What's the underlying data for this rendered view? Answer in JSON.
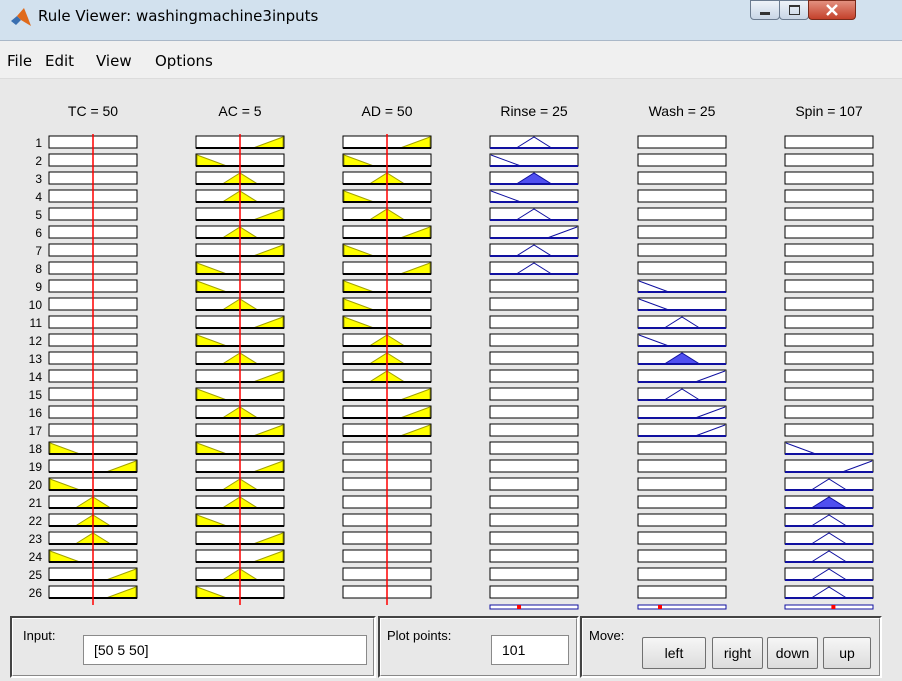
{
  "window": {
    "title": "Rule Viewer: washingmachine3inputs",
    "controls": {
      "minimize": "minimize-icon",
      "maximize": "maximize-icon",
      "close": "close-icon"
    }
  },
  "menu": {
    "items": [
      "File",
      "Edit",
      "View",
      "Options"
    ]
  },
  "variables": [
    {
      "header": "TC = 50",
      "role": "input"
    },
    {
      "header": "AC = 5",
      "role": "input"
    },
    {
      "header": "AD = 50",
      "role": "input"
    },
    {
      "header": "Rinse = 25",
      "role": "output"
    },
    {
      "header": "Wash = 25",
      "role": "output"
    },
    {
      "header": "Spin = 107",
      "role": "output"
    }
  ],
  "rule_count": 26,
  "rules": [
    [
      "-",
      "H",
      "H",
      "M",
      "-",
      "-"
    ],
    [
      "-",
      "L",
      "L",
      "L",
      "-",
      "-"
    ],
    [
      "-",
      "M",
      "M",
      "M*",
      "-",
      "-"
    ],
    [
      "-",
      "M",
      "L",
      "L",
      "-",
      "-"
    ],
    [
      "-",
      "H",
      "M",
      "M",
      "-",
      "-"
    ],
    [
      "-",
      "M",
      "H",
      "H",
      "-",
      "-"
    ],
    [
      "-",
      "H",
      "L",
      "M",
      "-",
      "-"
    ],
    [
      "-",
      "L",
      "H",
      "M",
      "-",
      "-"
    ],
    [
      "-",
      "L",
      "L",
      "-",
      "L",
      "-"
    ],
    [
      "-",
      "M",
      "L",
      "-",
      "L",
      "-"
    ],
    [
      "-",
      "H",
      "L",
      "-",
      "M",
      "-"
    ],
    [
      "-",
      "L",
      "M",
      "-",
      "L",
      "-"
    ],
    [
      "-",
      "M",
      "M",
      "-",
      "M*",
      "-"
    ],
    [
      "-",
      "H",
      "M",
      "-",
      "H",
      "-"
    ],
    [
      "-",
      "L",
      "H",
      "-",
      "M",
      "-"
    ],
    [
      "-",
      "M",
      "H",
      "-",
      "H",
      "-"
    ],
    [
      "-",
      "H",
      "H",
      "-",
      "H",
      "-"
    ],
    [
      "L",
      "L",
      "-",
      "-",
      "-",
      "L"
    ],
    [
      "H",
      "H",
      "-",
      "-",
      "-",
      "H"
    ],
    [
      "L",
      "M",
      "-",
      "-",
      "-",
      "M"
    ],
    [
      "M",
      "M",
      "-",
      "-",
      "-",
      "M*"
    ],
    [
      "M",
      "L",
      "-",
      "-",
      "-",
      "M"
    ],
    [
      "M",
      "H",
      "-",
      "-",
      "-",
      "M"
    ],
    [
      "L",
      "H",
      "-",
      "-",
      "-",
      "M"
    ],
    [
      "H",
      "M",
      "-",
      "-",
      "-",
      "M"
    ],
    [
      "H",
      "L",
      "-",
      "-",
      "-",
      "M"
    ]
  ],
  "input_marker_fraction": [
    0.5,
    0.5,
    0.5
  ],
  "output_marker_fraction": [
    0.33,
    0.25,
    0.55
  ],
  "colors": {
    "input_fill": "#ffff00",
    "input_edge": "#a0a000",
    "output_fill": "#5050f0",
    "output_edge": "#1010a0",
    "marker": "#ff0000"
  },
  "controls": {
    "input_label": "Input:",
    "input_value": "[50 5 50]",
    "plot_points_label": "Plot points:",
    "plot_points_value": "101",
    "move_label": "Move:",
    "buttons": [
      "left",
      "right",
      "down",
      "up"
    ]
  }
}
